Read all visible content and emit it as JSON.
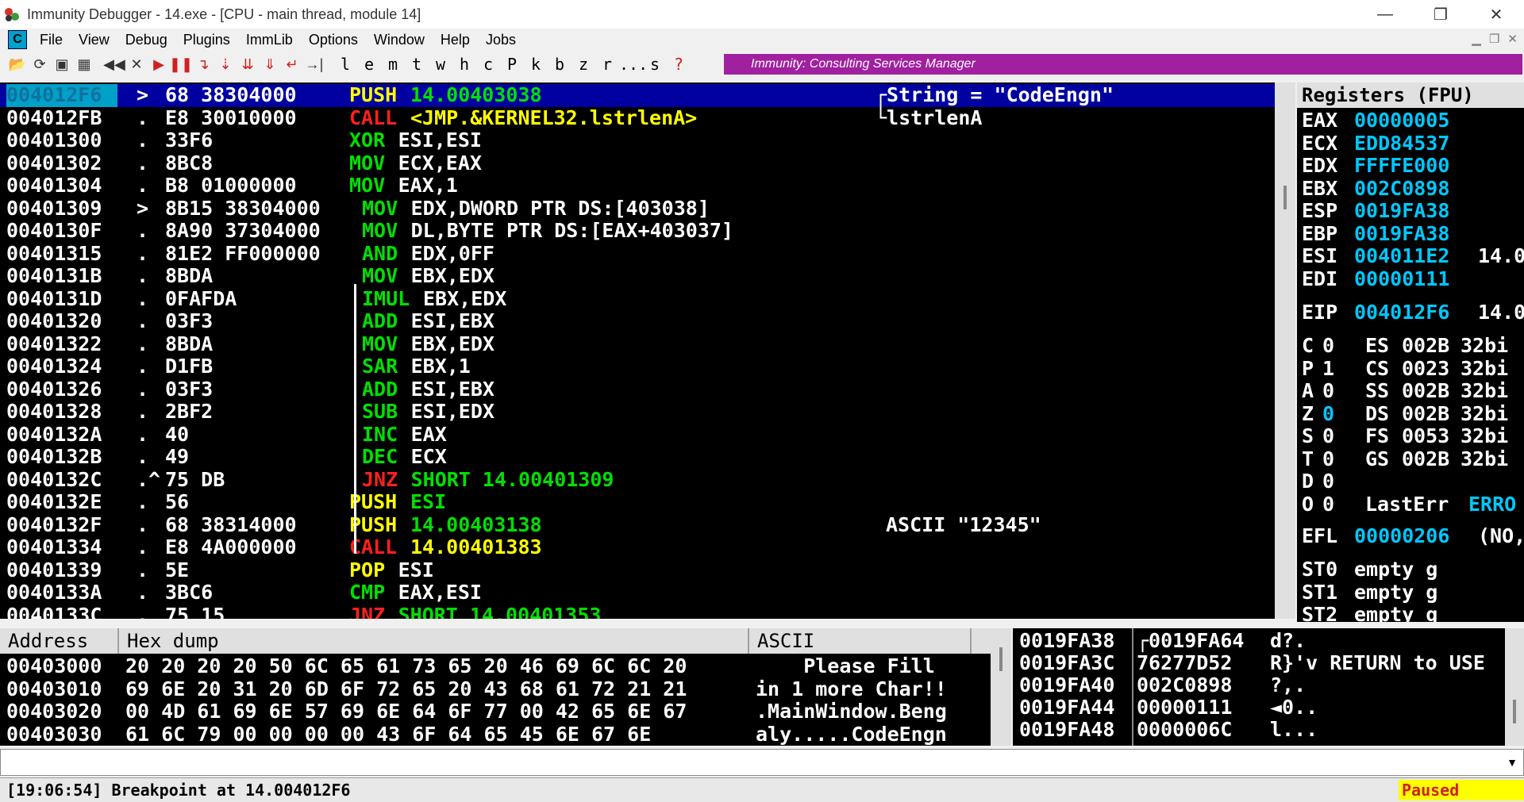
{
  "window": {
    "title": "Immunity Debugger - 14.exe - [CPU - main thread, module 14]",
    "minimize": "—",
    "restore": "❐",
    "close": "✕"
  },
  "menu": {
    "icon_label": "C",
    "items": [
      "File",
      "View",
      "Debug",
      "Plugins",
      "ImmLib",
      "Options",
      "Window",
      "Help",
      "Jobs"
    ]
  },
  "toolbar": {
    "letters": [
      "l",
      "e",
      "m",
      "t",
      "w",
      "h",
      "c",
      "P",
      "k",
      "b",
      "z",
      "r",
      "...",
      "s",
      "?"
    ],
    "banner": "Immunity: Consulting Services Manager"
  },
  "disasm": {
    "rows": [
      {
        "addr": "004012F6",
        "mark": ">",
        "hex": "68 38304000",
        "op": "PUSH",
        "args": "14.00403038",
        "comment": "┌String = \"CodeEngn\""
      },
      {
        "addr": "004012FB",
        "mark": ".",
        "hex": "E8 30010000",
        "op": "CALL",
        "args": "<JMP.&KERNEL32.lstrlenA>",
        "comment": "└lstrlenA"
      },
      {
        "addr": "00401300",
        "mark": ".",
        "hex": "33F6",
        "op": "XOR",
        "args": "ESI,ESI",
        "comment": ""
      },
      {
        "addr": "00401302",
        "mark": ".",
        "hex": "8BC8",
        "op": "MOV",
        "args": "ECX,EAX",
        "comment": ""
      },
      {
        "addr": "00401304",
        "mark": ".",
        "hex": "B8 01000000",
        "op": "MOV",
        "args": "EAX,1",
        "comment": ""
      },
      {
        "addr": "00401309",
        "mark": ">",
        "hex": "8B15 38304000",
        "op": "MOV",
        "args": "EDX,DWORD PTR DS:[403038]",
        "comment": ""
      },
      {
        "addr": "0040130F",
        "mark": ".",
        "hex": "8A90 37304000",
        "op": "MOV",
        "args": "DL,BYTE PTR DS:[EAX+403037]",
        "comment": ""
      },
      {
        "addr": "00401315",
        "mark": ".",
        "hex": "81E2 FF000000",
        "op": "AND",
        "args": "EDX,0FF",
        "comment": ""
      },
      {
        "addr": "0040131B",
        "mark": ".",
        "hex": "8BDA",
        "op": "MOV",
        "args": "EBX,EDX",
        "comment": ""
      },
      {
        "addr": "0040131D",
        "mark": ".",
        "hex": "0FAFDA",
        "op": "IMUL",
        "args": "EBX,EDX",
        "comment": ""
      },
      {
        "addr": "00401320",
        "mark": ".",
        "hex": "03F3",
        "op": "ADD",
        "args": "ESI,EBX",
        "comment": ""
      },
      {
        "addr": "00401322",
        "mark": ".",
        "hex": "8BDA",
        "op": "MOV",
        "args": "EBX,EDX",
        "comment": ""
      },
      {
        "addr": "00401324",
        "mark": ".",
        "hex": "D1FB",
        "op": "SAR",
        "args": "EBX,1",
        "comment": ""
      },
      {
        "addr": "00401326",
        "mark": ".",
        "hex": "03F3",
        "op": "ADD",
        "args": "ESI,EBX",
        "comment": ""
      },
      {
        "addr": "00401328",
        "mark": ".",
        "hex": "2BF2",
        "op": "SUB",
        "args": "ESI,EDX",
        "comment": ""
      },
      {
        "addr": "0040132A",
        "mark": ".",
        "hex": "40",
        "op": "INC",
        "args": "EAX",
        "comment": ""
      },
      {
        "addr": "0040132B",
        "mark": ".",
        "hex": "49",
        "op": "DEC",
        "args": "ECX",
        "comment": ""
      },
      {
        "addr": "0040132C",
        "mark": ".^",
        "hex": "75 DB",
        "op": "JNZ",
        "args": "SHORT 14.00401309",
        "comment": ""
      },
      {
        "addr": "0040132E",
        "mark": ".",
        "hex": "56",
        "op": "PUSH",
        "args": "ESI",
        "comment": ""
      },
      {
        "addr": "0040132F",
        "mark": ".",
        "hex": "68 38314000",
        "op": "PUSH",
        "args": "14.00403138",
        "comment": "ASCII \"12345\""
      },
      {
        "addr": "00401334",
        "mark": ".",
        "hex": "E8 4A000000",
        "op": "CALL",
        "args": "14.00401383",
        "comment": ""
      },
      {
        "addr": "00401339",
        "mark": ".",
        "hex": "5E",
        "op": "POP",
        "args": "ESI",
        "comment": ""
      },
      {
        "addr": "0040133A",
        "mark": ".",
        "hex": "3BC6",
        "op": "CMP",
        "args": "EAX,ESI",
        "comment": ""
      },
      {
        "addr": "0040133C",
        "mark": ".",
        "hex": "75 15",
        "op": "JNZ",
        "args": "SHORT 14.00401353",
        "comment": ""
      }
    ]
  },
  "registers": {
    "header": "Registers (FPU)",
    "general": [
      {
        "name": "EAX",
        "value": "00000005",
        "extra": ""
      },
      {
        "name": "ECX",
        "value": "EDD84537",
        "extra": ""
      },
      {
        "name": "EDX",
        "value": "FFFFE000",
        "extra": ""
      },
      {
        "name": "EBX",
        "value": "002C0898",
        "extra": ""
      },
      {
        "name": "ESP",
        "value": "0019FA38",
        "extra": ""
      },
      {
        "name": "EBP",
        "value": "0019FA38",
        "extra": ""
      },
      {
        "name": "ESI",
        "value": "004011E2",
        "extra": "14.0"
      },
      {
        "name": "EDI",
        "value": "00000111",
        "extra": ""
      }
    ],
    "eip": {
      "name": "EIP",
      "value": "004012F6",
      "extra": "14.0"
    },
    "flags": [
      {
        "flag": "C",
        "val": "0",
        "seg": "ES",
        "segval": "002B",
        "bits": "32bi"
      },
      {
        "flag": "P",
        "val": "1",
        "seg": "CS",
        "segval": "0023",
        "bits": "32bi"
      },
      {
        "flag": "A",
        "val": "0",
        "seg": "SS",
        "segval": "002B",
        "bits": "32bi"
      },
      {
        "flag": "Z",
        "val": "0",
        "seg": "DS",
        "segval": "002B",
        "bits": "32bi"
      },
      {
        "flag": "S",
        "val": "0",
        "seg": "FS",
        "segval": "0053",
        "bits": "32bi"
      },
      {
        "flag": "T",
        "val": "0",
        "seg": "GS",
        "segval": "002B",
        "bits": "32bi"
      },
      {
        "flag": "D",
        "val": "0",
        "seg": "",
        "segval": "",
        "bits": ""
      },
      {
        "flag": "O",
        "val": "0",
        "seg": "LastErr",
        "segval": "ERRO",
        "bits": ""
      }
    ],
    "efl": {
      "name": "EFL",
      "value": "00000206",
      "extra": "(NO,"
    },
    "fpu": [
      {
        "name": "ST0",
        "value": "empty g"
      },
      {
        "name": "ST1",
        "value": "empty g"
      },
      {
        "name": "ST2",
        "value": "empty g"
      }
    ]
  },
  "dump": {
    "headers": {
      "address": "Address",
      "hex": "Hex dump",
      "ascii": "ASCII"
    },
    "rows": [
      {
        "addr": "00403000",
        "hex": "20 20 20 20 50 6C 65 61 73 65 20 46 69 6C 6C 20",
        "ascii": "    Please Fill"
      },
      {
        "addr": "00403010",
        "hex": "69 6E 20 31 20 6D 6F 72 65 20 43 68 61 72 21 21",
        "ascii": "in 1 more Char!!"
      },
      {
        "addr": "00403020",
        "hex": "00 4D 61 69 6E 57 69 6E 64 6F 77 00 42 65 6E 67",
        "ascii": ".MainWindow.Beng"
      },
      {
        "addr": "00403030",
        "hex": "61 6C 79 00 00 00 00 43 6F 64 65 45 6E 67 6E",
        "ascii": "aly.....CodeEngn"
      }
    ]
  },
  "stack": {
    "rows": [
      {
        "addr": "0019FA38",
        "value": "┌0019FA64",
        "comment": "d?."
      },
      {
        "addr": "0019FA3C",
        "value": "76277D52",
        "comment": "R}'v RETURN to USE"
      },
      {
        "addr": "0019FA40",
        "value": "002C0898",
        "comment": "?,."
      },
      {
        "addr": "0019FA44",
        "value": "00000111",
        "comment": "◄0.."
      },
      {
        "addr": "0019FA48",
        "value": "0000006C",
        "comment": "l..."
      }
    ]
  },
  "status": {
    "message": "[19:06:54] Breakpoint at 14.004012F6",
    "state": "Paused"
  },
  "colors": {
    "selection": "#0000a0",
    "banner": "#a020a0",
    "state_bg": "#ffff00"
  }
}
